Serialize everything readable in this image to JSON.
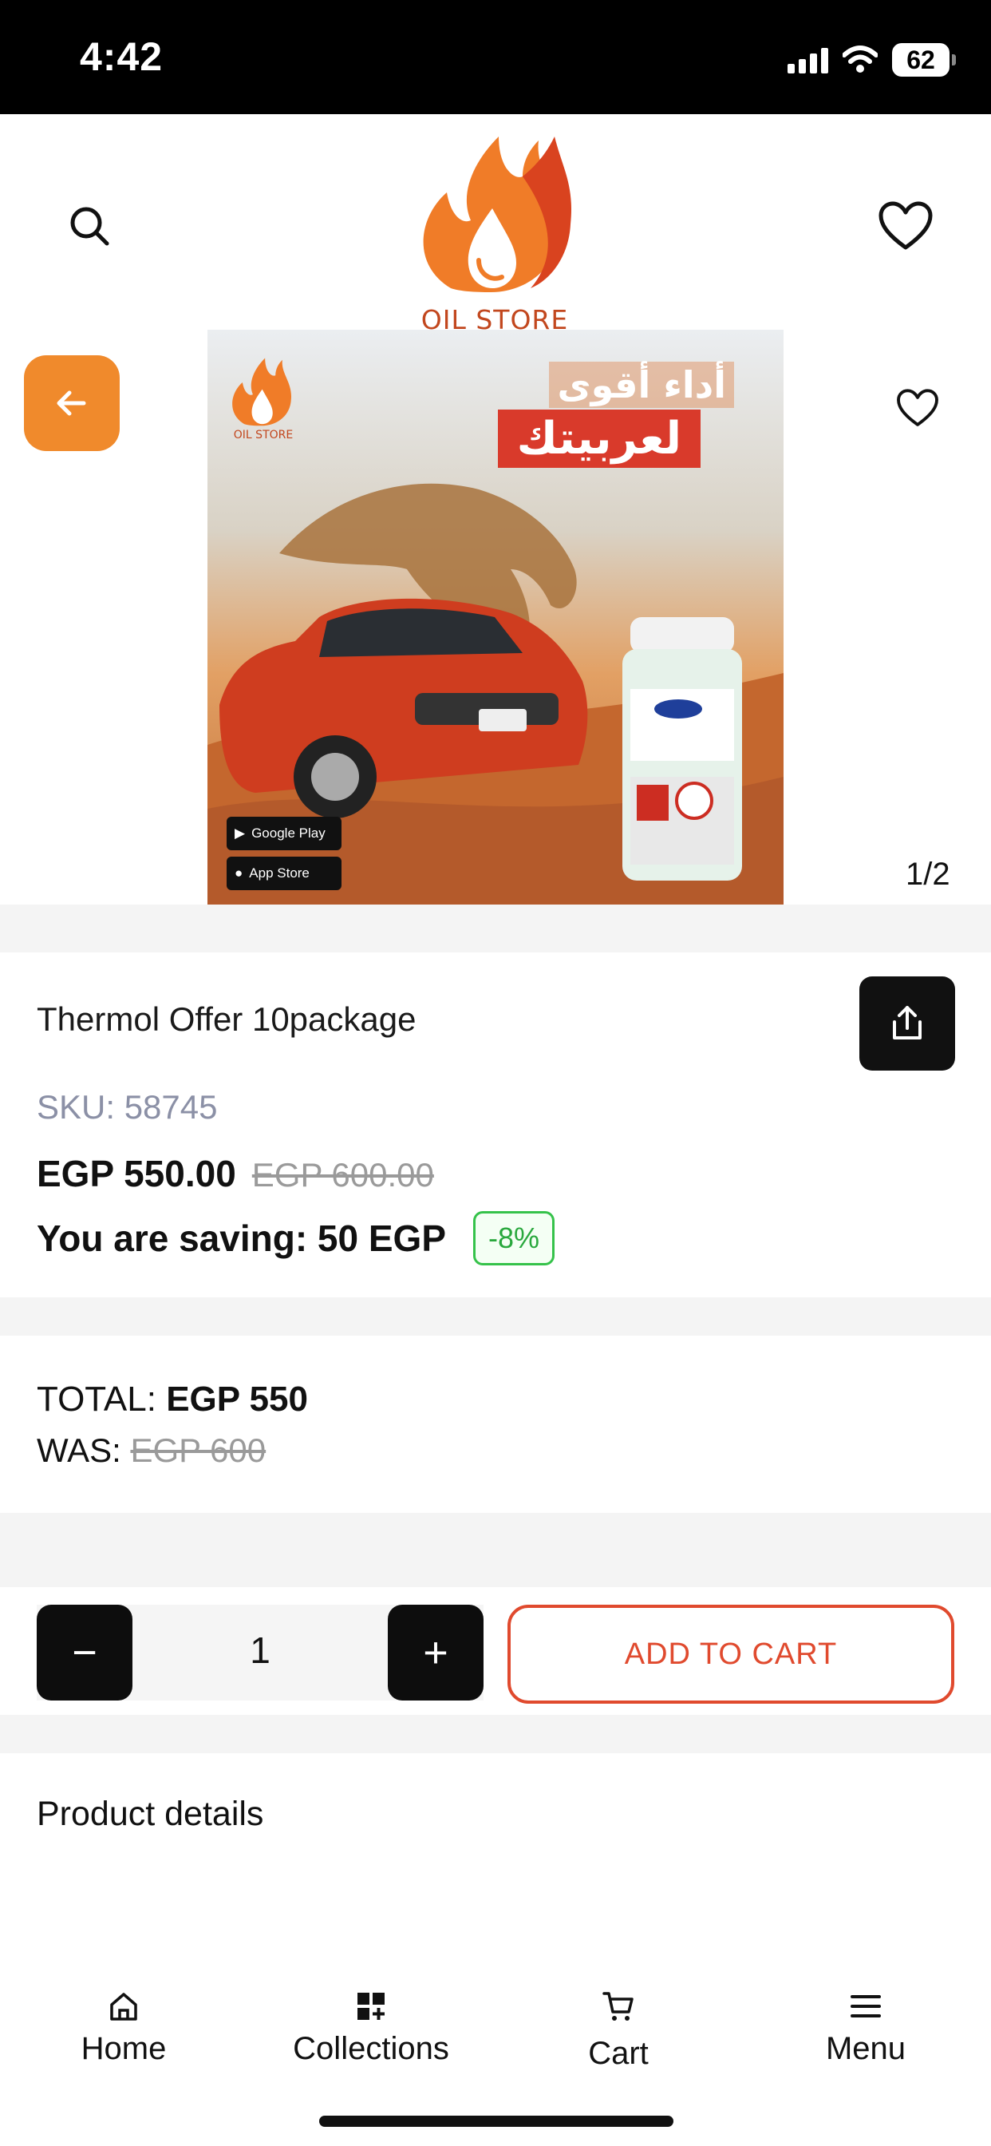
{
  "status_bar": {
    "time": "4:42",
    "battery": "62"
  },
  "header": {
    "logo_text": "OIL STORE"
  },
  "gallery": {
    "image_text": {
      "headline": "أداء أقوى",
      "banner": "لعربيتك",
      "logo_text": "OIL STORE",
      "google_play": "Google Play",
      "app_store": "App Store"
    },
    "pager": "1/2"
  },
  "product": {
    "title": "Thermol Offer 10package",
    "sku_label": "SKU:",
    "sku_value": "58745",
    "price": "EGP 550.00",
    "old_price": "EGP 600.00",
    "saving": "You are saving: 50 EGP",
    "discount": "-8%"
  },
  "totals": {
    "total_label": "TOTAL:",
    "total_value": "EGP 550",
    "was_label": "WAS:",
    "was_value": "EGP 600"
  },
  "cart": {
    "minus": "−",
    "quantity": "1",
    "plus": "+",
    "add_to_cart": "ADD TO CART"
  },
  "details": {
    "title": "Product details"
  },
  "nav": {
    "home": "Home",
    "collections": "Collections",
    "cart": "Cart",
    "menu": "Menu"
  },
  "colors": {
    "accent_orange": "#f08a2c",
    "add_to_cart_red": "#e04a2e",
    "discount_green": "#35c24a",
    "sku_gray": "#8b90a6"
  },
  "icons": [
    "search-icon",
    "heart-icon",
    "arrow-left-icon",
    "share-icon",
    "home-icon",
    "collections-icon",
    "cart-icon",
    "menu-icon"
  ]
}
